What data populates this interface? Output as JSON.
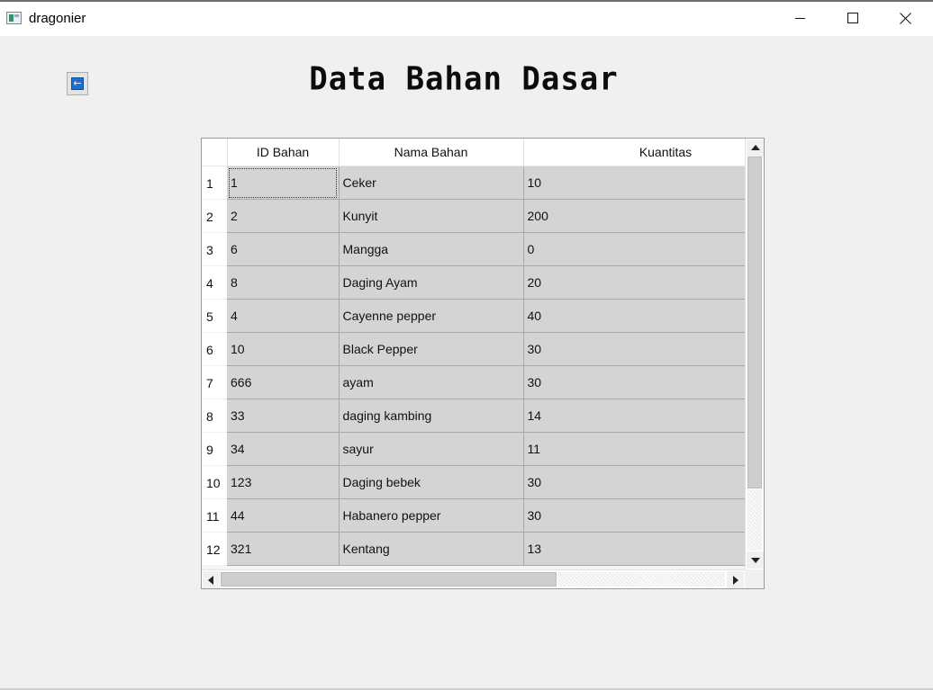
{
  "window": {
    "title": "dragonier",
    "controls": {
      "minimize_icon": "minimize-icon",
      "maximize_icon": "maximize-icon",
      "close_icon": "close-icon"
    }
  },
  "page": {
    "title": "Data Bahan Dasar",
    "back_button": {
      "icon": "back-arrow-icon",
      "glyph": "←",
      "color": "#1a6fd1"
    }
  },
  "table": {
    "columns": [
      "ID Bahan",
      "Nama Bahan",
      "Kuantitas"
    ],
    "row_numbers": [
      "1",
      "2",
      "3",
      "4",
      "5",
      "6",
      "7",
      "8",
      "9",
      "10",
      "11",
      "12"
    ],
    "rows": [
      [
        "1",
        "Ceker",
        "10"
      ],
      [
        "2",
        "Kunyit",
        "200"
      ],
      [
        "6",
        "Mangga",
        "0"
      ],
      [
        "8",
        "Daging Ayam",
        "20"
      ],
      [
        "4",
        "Cayenne pepper",
        "40"
      ],
      [
        "10",
        "Black Pepper",
        "30"
      ],
      [
        "666",
        "ayam",
        "30"
      ],
      [
        "33",
        "daging kambing",
        "14"
      ],
      [
        "34",
        "sayur",
        "11"
      ],
      [
        "123",
        "Daging bebek",
        "30"
      ],
      [
        "44",
        "Habanero pepper",
        "30"
      ],
      [
        "321",
        "Kentang",
        "13"
      ]
    ],
    "selected_cell": {
      "row": 0,
      "col": 0
    },
    "cell_background": "#d4d4d4"
  }
}
